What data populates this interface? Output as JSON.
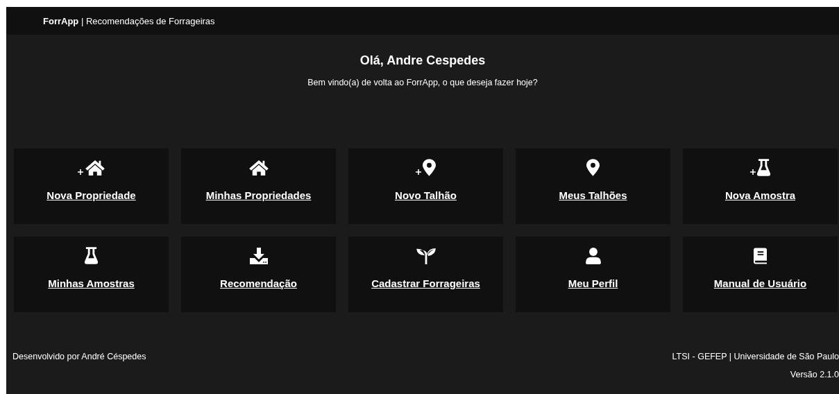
{
  "header": {
    "brand": "ForrApp",
    "separator": "|",
    "subtitle": "Recomendações de Forrageiras"
  },
  "greeting": {
    "title": "Olá, Andre Cespedes",
    "message": "Bem vindo(a) de volta ao ForrApp, o que deseja fazer hoje?"
  },
  "tiles": [
    {
      "label": "Nova Propriedade",
      "kind": "house",
      "plus": true
    },
    {
      "label": "Minhas Propriedades",
      "kind": "house",
      "plus": false
    },
    {
      "label": "Novo Talhão",
      "kind": "pin",
      "plus": true
    },
    {
      "label": "Meus Talhões",
      "kind": "pin",
      "plus": false
    },
    {
      "label": "Nova Amostra",
      "kind": "flask",
      "plus": true
    },
    {
      "label": "Minhas Amostras",
      "kind": "flask",
      "plus": false
    },
    {
      "label": "Recomendação",
      "kind": "download",
      "plus": false
    },
    {
      "label": "Cadastrar Forrageiras",
      "kind": "seedling",
      "plus": false
    },
    {
      "label": "Meu Perfil",
      "kind": "user",
      "plus": false
    },
    {
      "label": "Manual de Usuário",
      "kind": "book",
      "plus": false
    }
  ],
  "footer": {
    "credit": "Desenvolvido por André Céspedes",
    "institution": "LTSI - GEFEP | Universidade de São Paulo",
    "version": "Versão 2.1.0"
  }
}
